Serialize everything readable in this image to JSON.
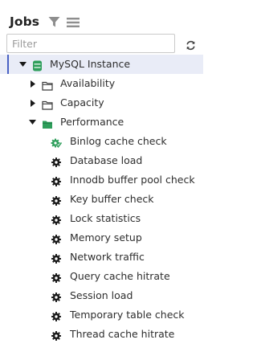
{
  "panel": {
    "title": "Jobs",
    "filter_placeholder": "Filter",
    "filter_value": ""
  },
  "tree": {
    "root": {
      "label": "MySQL Instance",
      "icon": "database-icon",
      "expanded": true,
      "selected": true
    },
    "groups": [
      {
        "label": "Availability",
        "icon": "folder-icon",
        "expanded": false
      },
      {
        "label": "Capacity",
        "icon": "folder-icon",
        "expanded": false
      },
      {
        "label": "Performance",
        "icon": "folder-open-icon",
        "expanded": true
      }
    ],
    "jobs": [
      {
        "label": "Binlog cache check",
        "icon": "gear-check-icon"
      },
      {
        "label": "Database load",
        "icon": "gear-icon"
      },
      {
        "label": "Innodb buffer pool check",
        "icon": "gear-icon"
      },
      {
        "label": "Key buffer check",
        "icon": "gear-icon"
      },
      {
        "label": "Lock statistics",
        "icon": "gear-icon"
      },
      {
        "label": "Memory setup",
        "icon": "gear-icon"
      },
      {
        "label": "Network traffic",
        "icon": "gear-icon"
      },
      {
        "label": "Query cache hitrate",
        "icon": "gear-icon"
      },
      {
        "label": "Session load",
        "icon": "gear-icon"
      },
      {
        "label": "Temporary table check",
        "icon": "gear-icon"
      },
      {
        "label": "Thread cache hitrate",
        "icon": "gear-icon"
      }
    ]
  },
  "colors": {
    "selection_bg": "#e9ecf7",
    "selection_bar": "#4a62c4",
    "database_green": "#2e9e5b",
    "folder_green": "#2e9e5b",
    "job_success_green": "#2e9e5b"
  }
}
